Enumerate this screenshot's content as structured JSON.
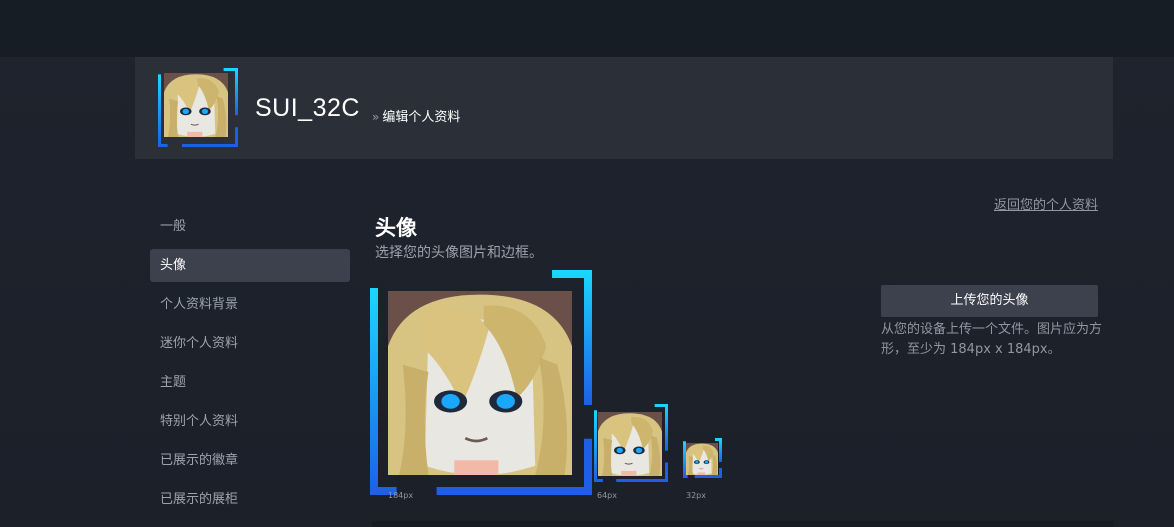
{
  "header": {
    "persona_name": "SUI_32C",
    "breadcrumb_sep": "»",
    "breadcrumb": "编辑个人资料"
  },
  "back_link": "返回您的个人资料",
  "sidebar": {
    "items": [
      {
        "label": "一般",
        "active": false
      },
      {
        "label": "头像",
        "active": true
      },
      {
        "label": "个人资料背景",
        "active": false
      },
      {
        "label": "迷你个人资料",
        "active": false
      },
      {
        "label": "主题",
        "active": false
      },
      {
        "label": "特别个人资料",
        "active": false
      },
      {
        "label": "已展示的徽章",
        "active": false
      },
      {
        "label": "已展示的展柜",
        "active": false
      }
    ]
  },
  "main": {
    "title": "头像",
    "subtitle": "选择您的头像图片和边框。",
    "previews": [
      {
        "size_label": "184px"
      },
      {
        "size_label": "64px"
      },
      {
        "size_label": "32px"
      }
    ],
    "upload_button": "上传您的头像",
    "upload_desc": "从您的设备上传一个文件。图片应为方形，至少为 184px x 184px。"
  },
  "colors": {
    "accent_cyan": "#1ad8ff",
    "accent_blue": "#1e5fe6",
    "active_nav": "#3d414d"
  }
}
